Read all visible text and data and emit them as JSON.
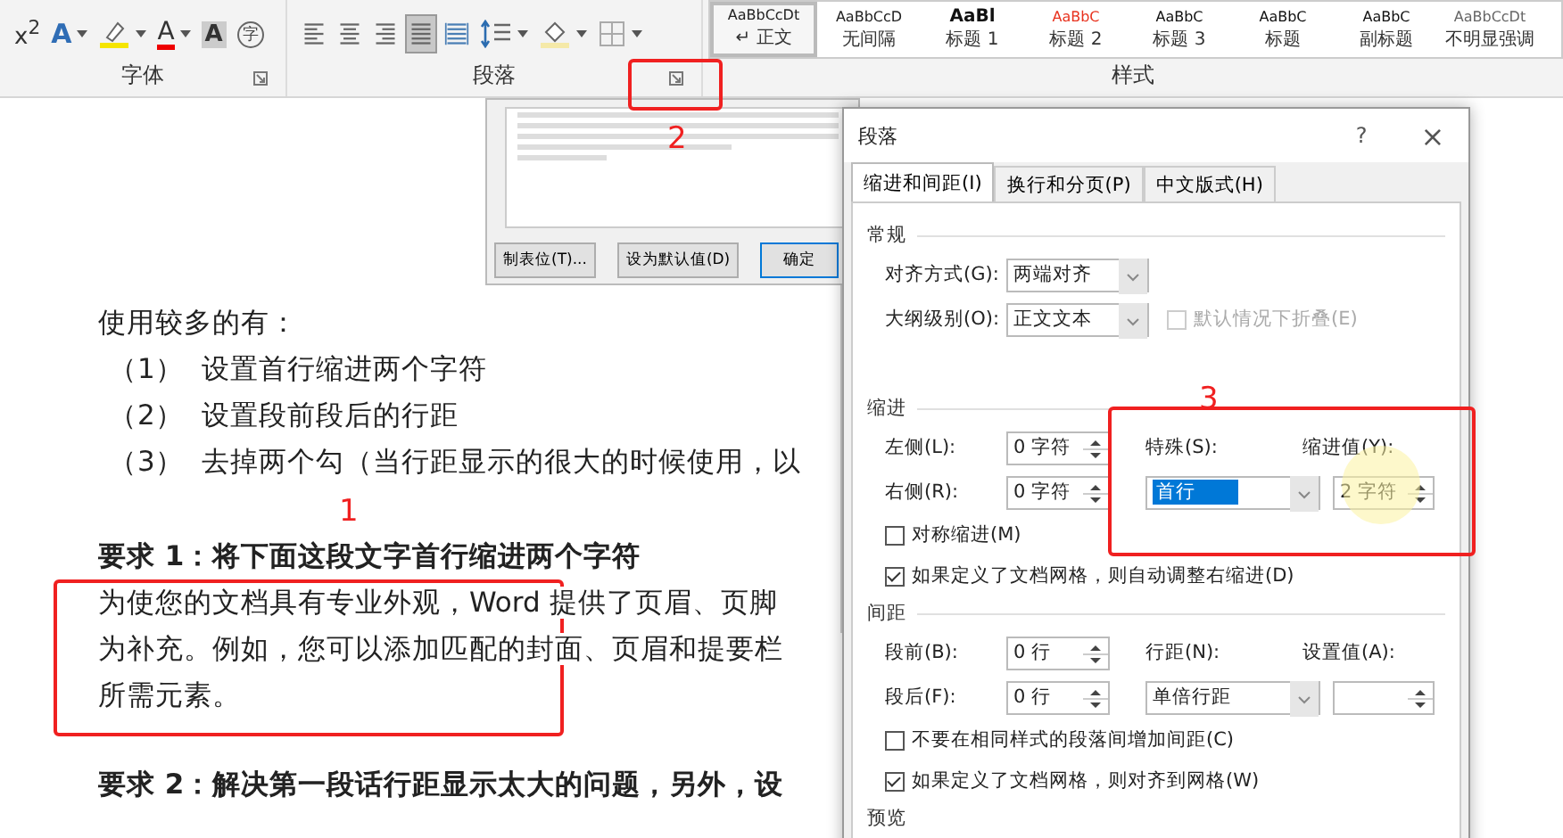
{
  "ribbon": {
    "font_tools": [
      {
        "kind": "superscript",
        "text": "x$^{2}$"
      },
      {
        "kind": "text-effect",
        "text": "A"
      },
      {
        "kind": "highlight"
      },
      {
        "kind": "font-color",
        "text": "A"
      },
      {
        "kind": "char-shading",
        "text": "A"
      },
      {
        "kind": "enclose",
        "text": "字"
      }
    ],
    "font_label": "字体",
    "paragraph_tools": [
      {
        "kind": "align-left",
        "selected": false
      },
      {
        "kind": "align-center",
        "selected": false
      },
      {
        "kind": "align-right",
        "selected": false
      },
      {
        "kind": "justify",
        "selected": true
      },
      {
        "kind": "distributed",
        "selected": false
      },
      {
        "kind": "line-spacing",
        "selected": false
      },
      {
        "kind": "shading",
        "selected": false
      },
      {
        "kind": "borders",
        "selected": false
      }
    ],
    "paragraph_label": "段落",
    "styles": [
      {
        "preview": "AaBbCcDt",
        "name": "↵ 正文",
        "selected": true,
        "color": "#222222"
      },
      {
        "preview": "AaBbCcD",
        "name": "无间隔",
        "selected": false,
        "color": "#222222"
      },
      {
        "preview": "AaBl",
        "name": "标题 1",
        "selected": false,
        "color": "#111111"
      },
      {
        "preview": "AaBbC",
        "name": "标题 2",
        "selected": false,
        "color": "#e8321e"
      },
      {
        "preview": "AaBbC",
        "name": "标题 3",
        "selected": false,
        "color": "#111111"
      },
      {
        "preview": "AaBbC",
        "name": "标题",
        "selected": false,
        "color": "#111111"
      },
      {
        "preview": "AaBbC",
        "name": "副标题",
        "selected": false,
        "color": "#111111"
      },
      {
        "preview": "AaBbCcDt",
        "name": "不明显强调",
        "selected": false,
        "color": "#666666"
      }
    ],
    "styles_label": "样式"
  },
  "document": {
    "intro": "使用较多的有：",
    "list": [
      {
        "number": "（1）",
        "text": "设置首行缩进两个字符"
      },
      {
        "number": "（2）",
        "text": "设置段前段后的行距"
      },
      {
        "number": "（3）",
        "text": "去掉两个勾（当行距显示的很大的时候使用，以"
      }
    ],
    "requirement_1": "要求 1：将下面这段文字首行缩进两个字符",
    "paragraph_lines": [
      "为使您的文档具有专业外观，Word 提供了页眉、页脚",
      "为补充。例如，您可以添加匹配的封面、页眉和提要栏",
      "所需元素。"
    ],
    "requirement_2": "要求 2：解决第一段话行距显示太大的问题，另外，设"
  },
  "back_dialog": {
    "buttons": [
      {
        "label": "制表位(T)...",
        "default": false
      },
      {
        "label": "设为默认值(D)",
        "default": false
      },
      {
        "label": "确定",
        "default": true
      }
    ]
  },
  "dialog": {
    "title": "段落",
    "help": "?",
    "close": "×",
    "tabs": [
      {
        "label": "缩进和间距(I)",
        "selected": true
      },
      {
        "label": "换行和分页(P)",
        "selected": false
      },
      {
        "label": "中文版式(H)",
        "selected": false
      }
    ],
    "general": {
      "heading": "常规",
      "alignment": {
        "label": "对齐方式(G):",
        "value": "两端对齐"
      },
      "outline": {
        "label": "大纲级别(O):",
        "value": "正文文本"
      },
      "collapse": {
        "label": "默认情况下折叠(E)",
        "checked": false,
        "disabled": true
      }
    },
    "indent": {
      "heading": "缩进",
      "left": {
        "label": "左侧(L):",
        "value": "0 字符"
      },
      "right": {
        "label": "右侧(R):",
        "value": "0 字符"
      },
      "special": {
        "label": "特殊(S):",
        "value": "首行",
        "focused": true
      },
      "by": {
        "label": "缩进值(Y):",
        "value": "2 字符"
      },
      "checks": [
        {
          "label": "对称缩进(M)",
          "checked": false,
          "disabled": false
        },
        {
          "label": "如果定义了文档网格，则自动调整右缩进(D)",
          "checked": true,
          "disabled": false
        }
      ]
    },
    "spacing": {
      "heading": "间距",
      "before": {
        "label": "段前(B):",
        "value": "0 行"
      },
      "after": {
        "label": "段后(F):",
        "value": "0 行"
      },
      "line": {
        "label": "行距(N):",
        "value": "单倍行距"
      },
      "at": {
        "label": "设置值(A):"
      },
      "checks": [
        {
          "label": "不要在相同样式的段落间增加间距(C)",
          "checked": false,
          "disabled": false
        },
        {
          "label": "如果定义了文档网格，则对齐到网格(W)",
          "checked": true,
          "disabled": false
        }
      ]
    },
    "preview_heading": "预览"
  },
  "annotations": [
    "1",
    "2",
    "3"
  ]
}
